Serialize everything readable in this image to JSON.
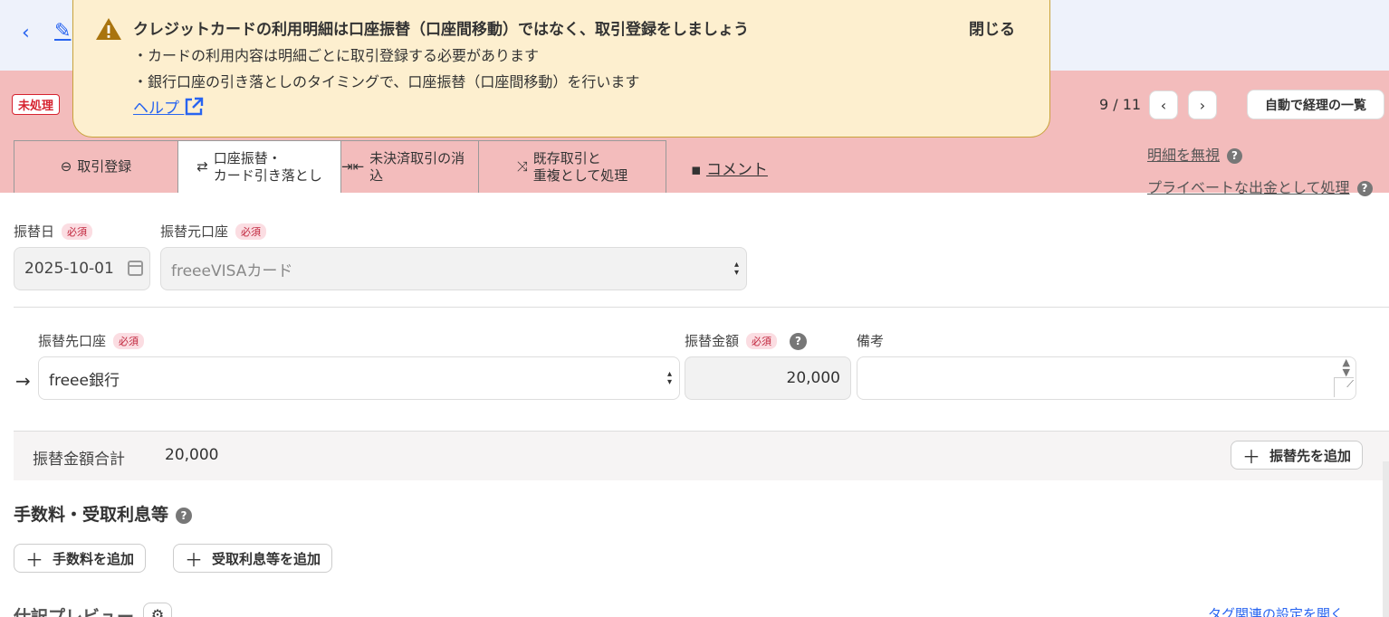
{
  "topbar": {
    "back_icon": "chevron-left-icon",
    "edit_icon": "edit-icon"
  },
  "toast": {
    "title": "クレジットカードの利用明細は口座振替（口座間移動）ではなく、取引登録をしましょう",
    "lines": [
      "・カードの利用内容は明細ごとに取引登録する必要があります",
      "・銀行口座の引き落としのタイミングで、口座振替（口座間移動）を行います"
    ],
    "help_label": "ヘルプ",
    "close_label": "閉じる"
  },
  "status_badge": "未処理",
  "pager": {
    "text": "9 / 11",
    "prev": "‹",
    "next": "›"
  },
  "auto_list_label": "自動で経理の一覧",
  "tabs": [
    {
      "label": "取引登録",
      "icon": "minus-circle-icon"
    },
    {
      "label_line1": "口座振替・",
      "label_line2": "カード引き落とし",
      "icon": "transfer-arrows-icon"
    },
    {
      "label": "未決済取引の消込",
      "icon": "merge-arrows-icon"
    },
    {
      "label_line1": "既存取引と",
      "label_line2": "重複として処理",
      "icon": "shuffle-icon"
    }
  ],
  "comment_label": "コメント",
  "right_links": {
    "ignore": "明細を無視",
    "private": "プライベートな出金として処理"
  },
  "form": {
    "required_label": "必須",
    "date_label": "振替日",
    "date_value": "2025-10-01",
    "source_label": "振替元口座",
    "source_value": "freeeVISAカード",
    "dest_label": "振替先口座",
    "dest_value": "freee銀行",
    "amount_label": "振替金額",
    "amount_value": "20,000",
    "memo_label": "備考",
    "memo_value": ""
  },
  "total": {
    "label": "振替金額合計",
    "value": "20,000",
    "add_dest_label": "振替先を追加"
  },
  "fees": {
    "title": "手数料・受取利息等",
    "add_fee_label": "手数料を追加",
    "add_interest_label": "受取利息等を追加"
  },
  "preview": {
    "title": "仕訳プレビュー",
    "tag_link": "タグ関連の設定を開く"
  }
}
